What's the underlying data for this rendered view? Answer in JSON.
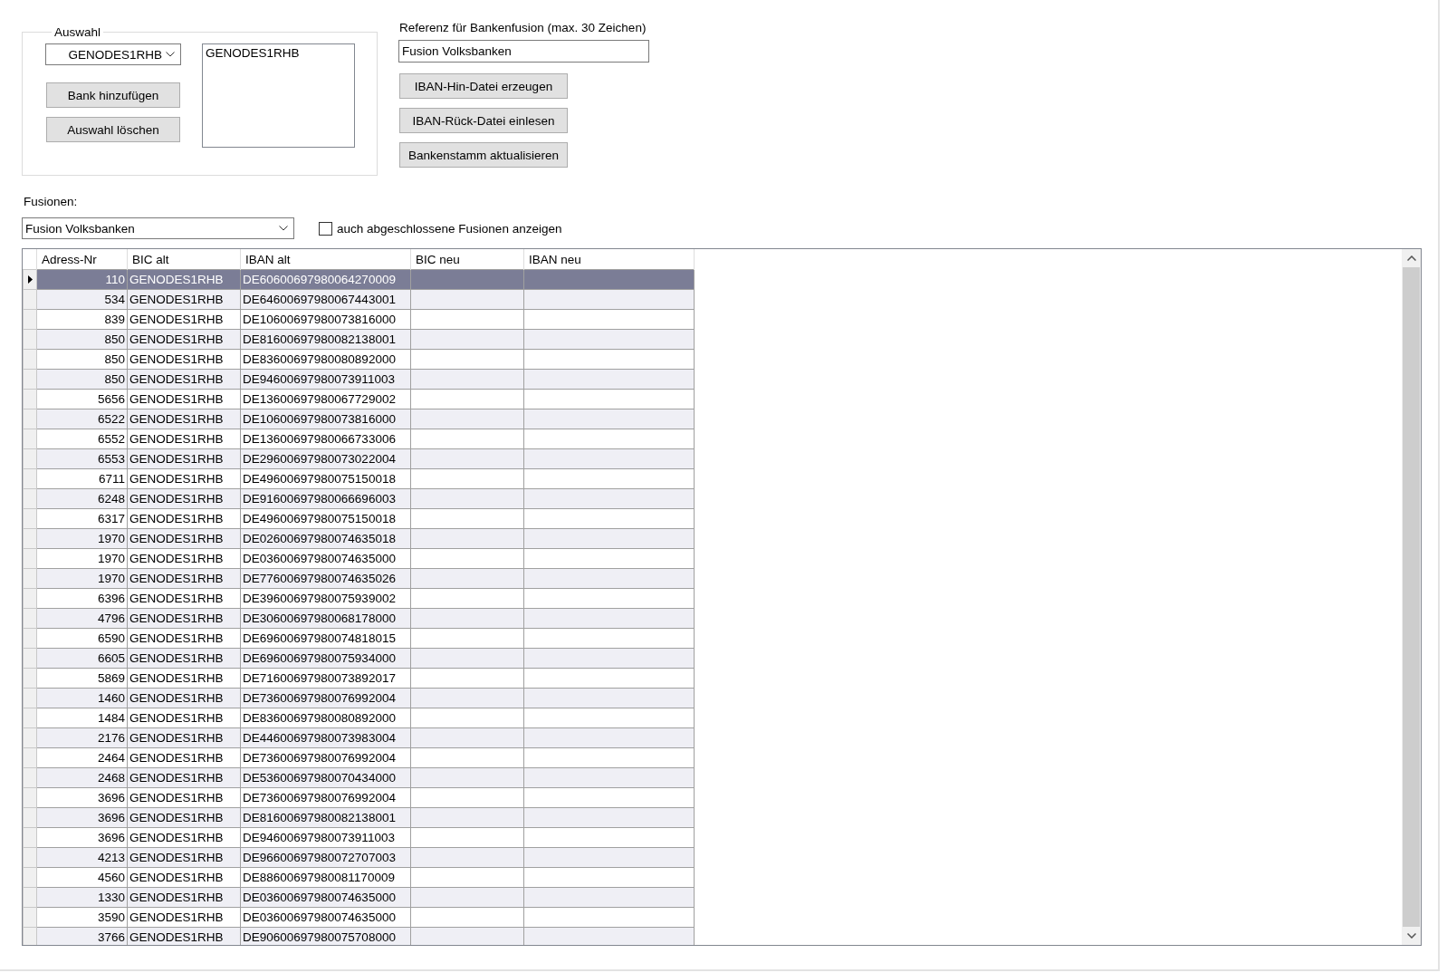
{
  "auswahl": {
    "title": "Auswahl",
    "bank_combo": {
      "value": "GENODES1RHB"
    },
    "buttons": [
      "Bank hinzufügen",
      "Auswahl löschen"
    ],
    "selected_banks": [
      "GENODES1RHB"
    ]
  },
  "referenz": {
    "label": "Referenz für Bankenfusion (max. 30 Zeichen)",
    "value": "Fusion Volksbanken",
    "buttons": [
      "IBAN-Hin-Datei erzeugen",
      "IBAN-Rück-Datei einlesen",
      "Bankenstamm aktualisieren"
    ]
  },
  "fusionen": {
    "label": "Fusionen:",
    "combo": {
      "value": "Fusion Volksbanken"
    },
    "checkbox": {
      "label": "auch abgeschlossene Fusionen anzeigen",
      "checked": false
    }
  },
  "table": {
    "columns": [
      "Adress-Nr",
      "BIC alt",
      "IBAN alt",
      "BIC neu",
      "IBAN neu"
    ],
    "rows": [
      {
        "selected": true,
        "cells": [
          "110",
          "GENODES1RHB",
          "DE60600697980064270009"
        ]
      },
      {
        "selected": false,
        "cells": [
          "534",
          "GENODES1RHB",
          "DE64600697980067443001"
        ]
      },
      {
        "selected": false,
        "cells": [
          "839",
          "GENODES1RHB",
          "DE10600697980073816000"
        ]
      },
      {
        "selected": false,
        "cells": [
          "850",
          "GENODES1RHB",
          "DE81600697980082138001"
        ]
      },
      {
        "selected": false,
        "cells": [
          "850",
          "GENODES1RHB",
          "DE83600697980080892000"
        ]
      },
      {
        "selected": false,
        "cells": [
          "850",
          "GENODES1RHB",
          "DE94600697980073911003"
        ]
      },
      {
        "selected": false,
        "cells": [
          "5656",
          "GENODES1RHB",
          "DE13600697980067729002"
        ]
      },
      {
        "selected": false,
        "cells": [
          "6522",
          "GENODES1RHB",
          "DE10600697980073816000"
        ]
      },
      {
        "selected": false,
        "cells": [
          "6552",
          "GENODES1RHB",
          "DE13600697980066733006"
        ]
      },
      {
        "selected": false,
        "cells": [
          "6553",
          "GENODES1RHB",
          "DE29600697980073022004"
        ]
      },
      {
        "selected": false,
        "cells": [
          "6711",
          "GENODES1RHB",
          "DE49600697980075150018"
        ]
      },
      {
        "selected": false,
        "cells": [
          "6248",
          "GENODES1RHB",
          "DE91600697980066696003"
        ]
      },
      {
        "selected": false,
        "cells": [
          "6317",
          "GENODES1RHB",
          "DE49600697980075150018"
        ]
      },
      {
        "selected": false,
        "cells": [
          "1970",
          "GENODES1RHB",
          "DE02600697980074635018"
        ]
      },
      {
        "selected": false,
        "cells": [
          "1970",
          "GENODES1RHB",
          "DE03600697980074635000"
        ]
      },
      {
        "selected": false,
        "cells": [
          "1970",
          "GENODES1RHB",
          "DE77600697980074635026"
        ]
      },
      {
        "selected": false,
        "cells": [
          "6396",
          "GENODES1RHB",
          "DE39600697980075939002"
        ]
      },
      {
        "selected": false,
        "cells": [
          "4796",
          "GENODES1RHB",
          "DE30600697980068178000"
        ]
      },
      {
        "selected": false,
        "cells": [
          "6590",
          "GENODES1RHB",
          "DE69600697980074818015"
        ]
      },
      {
        "selected": false,
        "cells": [
          "6605",
          "GENODES1RHB",
          "DE69600697980075934000"
        ]
      },
      {
        "selected": false,
        "cells": [
          "5869",
          "GENODES1RHB",
          "DE71600697980073892017"
        ]
      },
      {
        "selected": false,
        "cells": [
          "1460",
          "GENODES1RHB",
          "DE73600697980076992004"
        ]
      },
      {
        "selected": false,
        "cells": [
          "1484",
          "GENODES1RHB",
          "DE83600697980080892000"
        ]
      },
      {
        "selected": false,
        "cells": [
          "2176",
          "GENODES1RHB",
          "DE44600697980073983004"
        ]
      },
      {
        "selected": false,
        "cells": [
          "2464",
          "GENODES1RHB",
          "DE73600697980076992004"
        ]
      },
      {
        "selected": false,
        "cells": [
          "2468",
          "GENODES1RHB",
          "DE53600697980070434000"
        ]
      },
      {
        "selected": false,
        "cells": [
          "3696",
          "GENODES1RHB",
          "DE73600697980076992004"
        ]
      },
      {
        "selected": false,
        "cells": [
          "3696",
          "GENODES1RHB",
          "DE81600697980082138001"
        ]
      },
      {
        "selected": false,
        "cells": [
          "3696",
          "GENODES1RHB",
          "DE94600697980073911003"
        ]
      },
      {
        "selected": false,
        "cells": [
          "4213",
          "GENODES1RHB",
          "DE96600697980072707003"
        ]
      },
      {
        "selected": false,
        "cells": [
          "4560",
          "GENODES1RHB",
          "DE88600697980081170009"
        ]
      },
      {
        "selected": false,
        "cells": [
          "1330",
          "GENODES1RHB",
          "DE03600697980074635000"
        ]
      },
      {
        "selected": false,
        "cells": [
          "3590",
          "GENODES1RHB",
          "DE03600697980074635000"
        ]
      },
      {
        "selected": false,
        "cells": [
          "3766",
          "GENODES1RHB",
          "DE90600697980075708000"
        ]
      }
    ]
  }
}
